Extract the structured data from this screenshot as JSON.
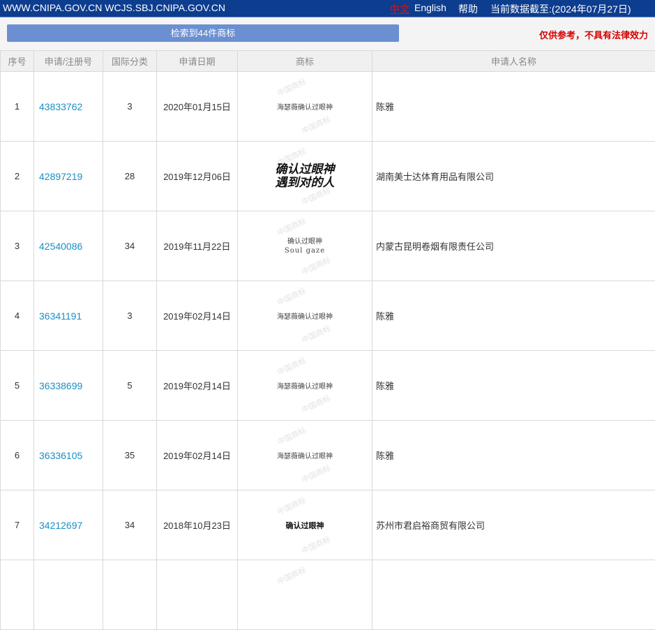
{
  "topbar": {
    "urls": "WWW.CNIPA.GOV.CN WCJS.SBJ.CNIPA.GOV.CN",
    "lang_cn": "中文",
    "lang_en": "English",
    "help": "帮助",
    "as_of": "当前数据截至:(2024年07月27日)"
  },
  "toolbar": {
    "result_label": "检索到44件商标",
    "disclaimer": "仅供参考，不具有法律效力"
  },
  "table": {
    "headers": [
      "序号",
      "申请/注册号",
      "国际分类",
      "申请日期",
      "商标",
      "申请人名称"
    ],
    "rows": [
      {
        "no": "1",
        "reg": "43833762",
        "cls": "3",
        "date": "2020年01月15日",
        "mark": "海瑟薇确认过眼神",
        "applicant": "陈雅"
      },
      {
        "no": "2",
        "reg": "42897219",
        "cls": "28",
        "date": "2019年12月06日",
        "mark": "确认过眼神",
        "mark2": "遇到对的人",
        "applicant": "湖南美士达体育用品有限公司"
      },
      {
        "no": "3",
        "reg": "42540086",
        "cls": "34",
        "date": "2019年11月22日",
        "mark": "确认过眼神",
        "mark2": "Soul gaze",
        "applicant": "内蒙古昆明卷烟有限责任公司"
      },
      {
        "no": "4",
        "reg": "36341191",
        "cls": "3",
        "date": "2019年02月14日",
        "mark": "海瑟薇确认过眼神",
        "applicant": "陈雅"
      },
      {
        "no": "5",
        "reg": "36338699",
        "cls": "5",
        "date": "2019年02月14日",
        "mark": "海瑟薇确认过眼神",
        "applicant": "陈雅"
      },
      {
        "no": "6",
        "reg": "36336105",
        "cls": "35",
        "date": "2019年02月14日",
        "mark": "海瑟薇确认过眼神",
        "applicant": "陈雅"
      },
      {
        "no": "7",
        "reg": "34212697",
        "cls": "34",
        "date": "2018年10月23日",
        "mark": "确认过眼神",
        "applicant": "苏州市君启裕商贸有限公司"
      }
    ],
    "watermark": "中国商标"
  },
  "colors": {
    "topbar_bg": "#0d3d8e",
    "button_bg": "#6b8fd1",
    "link": "#1a8fc4",
    "disclaimer": "#d40000"
  }
}
